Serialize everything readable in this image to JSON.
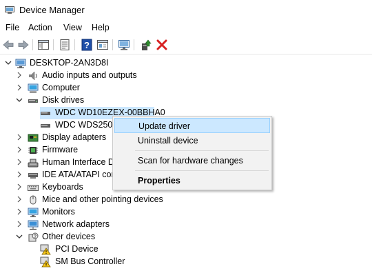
{
  "window": {
    "title": "Device Manager"
  },
  "menu": [
    "File",
    "Action",
    "View",
    "Help"
  ],
  "toolbar": {
    "buttons": [
      "back-arrow-icon",
      "forward-arrow-icon",
      "show-hide-tree-icon",
      "properties-sheet-icon",
      "help-icon",
      "view-panel-icon",
      "monitor-scan-icon",
      "update-driver-icon",
      "uninstall-x-icon"
    ],
    "colors": {
      "help": "#1f4fa8",
      "uninstall": "#d82020",
      "update": "#2e8b2e"
    }
  },
  "tree": {
    "root": "DESKTOP-2AN3D8I",
    "items": [
      {
        "label": "Audio inputs and outputs",
        "icon": "speaker-icon"
      },
      {
        "label": "Computer",
        "icon": "computer-icon"
      },
      {
        "label": "Disk drives",
        "icon": "disk-drive-icon",
        "expanded": true,
        "children": [
          "WDC WD10EZEX-00BBHA0",
          "WDC WDS250G2"
        ]
      },
      {
        "label": "Display adapters",
        "icon": "display-adapter-icon"
      },
      {
        "label": "Firmware",
        "icon": "firmware-icon"
      },
      {
        "label": "Human Interface De",
        "icon": "hid-icon"
      },
      {
        "label": "IDE ATA/ATAPI cont",
        "icon": "ide-controller-icon"
      },
      {
        "label": "Keyboards",
        "icon": "keyboard-icon"
      },
      {
        "label": "Mice and other pointing devices",
        "icon": "mouse-icon"
      },
      {
        "label": "Monitors",
        "icon": "monitor-icon"
      },
      {
        "label": "Network adapters",
        "icon": "network-adapter-icon"
      },
      {
        "label": "Other devices",
        "icon": "other-devices-icon",
        "expanded": true,
        "children": [
          "PCI Device",
          "SM Bus Controller"
        ]
      }
    ]
  },
  "context_menu": {
    "items": [
      "Update driver",
      "Uninstall device",
      "Scan for hardware changes",
      "Properties"
    ]
  },
  "selection_color": "#cce8ff"
}
